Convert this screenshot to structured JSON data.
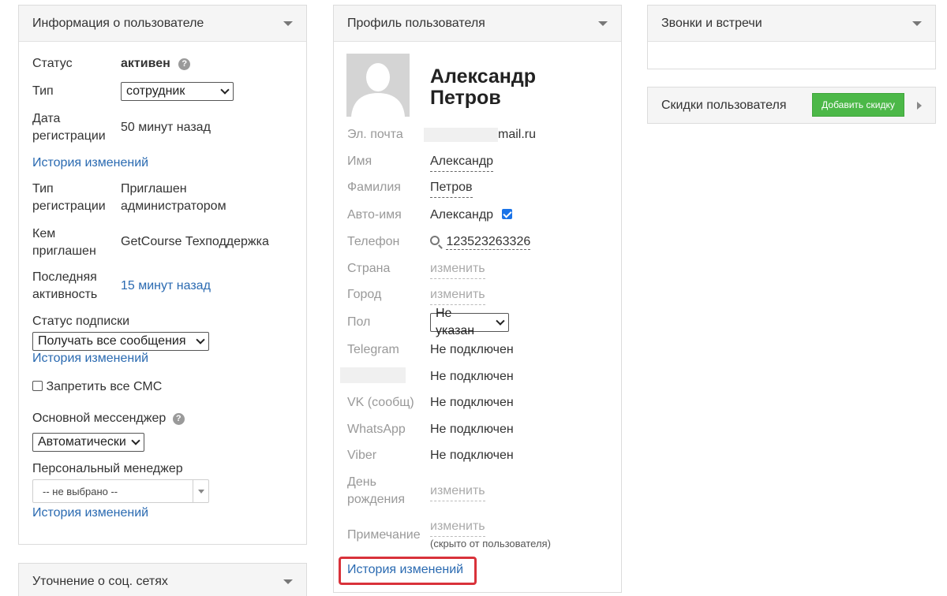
{
  "left_panel": {
    "title": "Информация о пользователе",
    "status_label": "Статус",
    "status_value": "активен",
    "type_label": "Тип",
    "type_select": "сотрудник",
    "reg_date_label_1": "Дата",
    "reg_date_label_2": "регистрации",
    "reg_date_value": "50 минут назад",
    "history_link": "История изменений",
    "reg_type_label_1": "Тип",
    "reg_type_label_2": "регистрации",
    "reg_type_value_1": "Приглашен",
    "reg_type_value_2": "администратором",
    "invited_label_1": "Кем",
    "invited_label_2": "приглашен",
    "invited_value": "GetCourse Техподдержка",
    "activity_label_1": "Последняя",
    "activity_label_2": "активность",
    "activity_value": "15 минут назад",
    "subscription_label": "Статус подписки",
    "subscription_select": "Получать все сообщения",
    "sms_label": "Запретить все СМС",
    "messenger_label": "Основной мессенджер",
    "messenger_select": "Автоматически",
    "manager_label": "Персональный менеджер",
    "manager_select": "-- не выбрано --"
  },
  "social_panel": {
    "title": "Уточнение о соц. сетях"
  },
  "profile_panel": {
    "first_name": "Александр",
    "last_name": "Петров",
    "title": "Профиль пользователя",
    "email_label": "Эл. почта",
    "email_value": "mail.ru",
    "name_label": "Имя",
    "name_value": "Александр",
    "surname_label": "Фамилия",
    "surname_value": "Петров",
    "autoname_label": "Авто-имя",
    "autoname_value": "Александр",
    "phone_label": "Телефон",
    "phone_value": "123523263326",
    "country_label": "Страна",
    "change": "изменить",
    "city_label": "Город",
    "gender_label": "Пол",
    "gender_select": "Не указан",
    "telegram_label": "Telegram",
    "not_connected": "Не подключен",
    "vk_label": "VK (сообщ)",
    "whatsapp_label": "WhatsApp",
    "viber_label": "Viber",
    "birthday_label_1": "День",
    "birthday_label_2": "рождения",
    "note_label": "Примечание",
    "note_hint": "(скрыто от пользователя)",
    "history_link": "История изменений"
  },
  "calls_panel": {
    "title": "Звонки и встречи"
  },
  "discounts_panel": {
    "title": "Скидки пользователя",
    "add_button": "Добавить скидку"
  },
  "colors": {
    "link": "#2a6ab1",
    "button_green": "#4cb848",
    "highlight_red": "#d9323a"
  }
}
